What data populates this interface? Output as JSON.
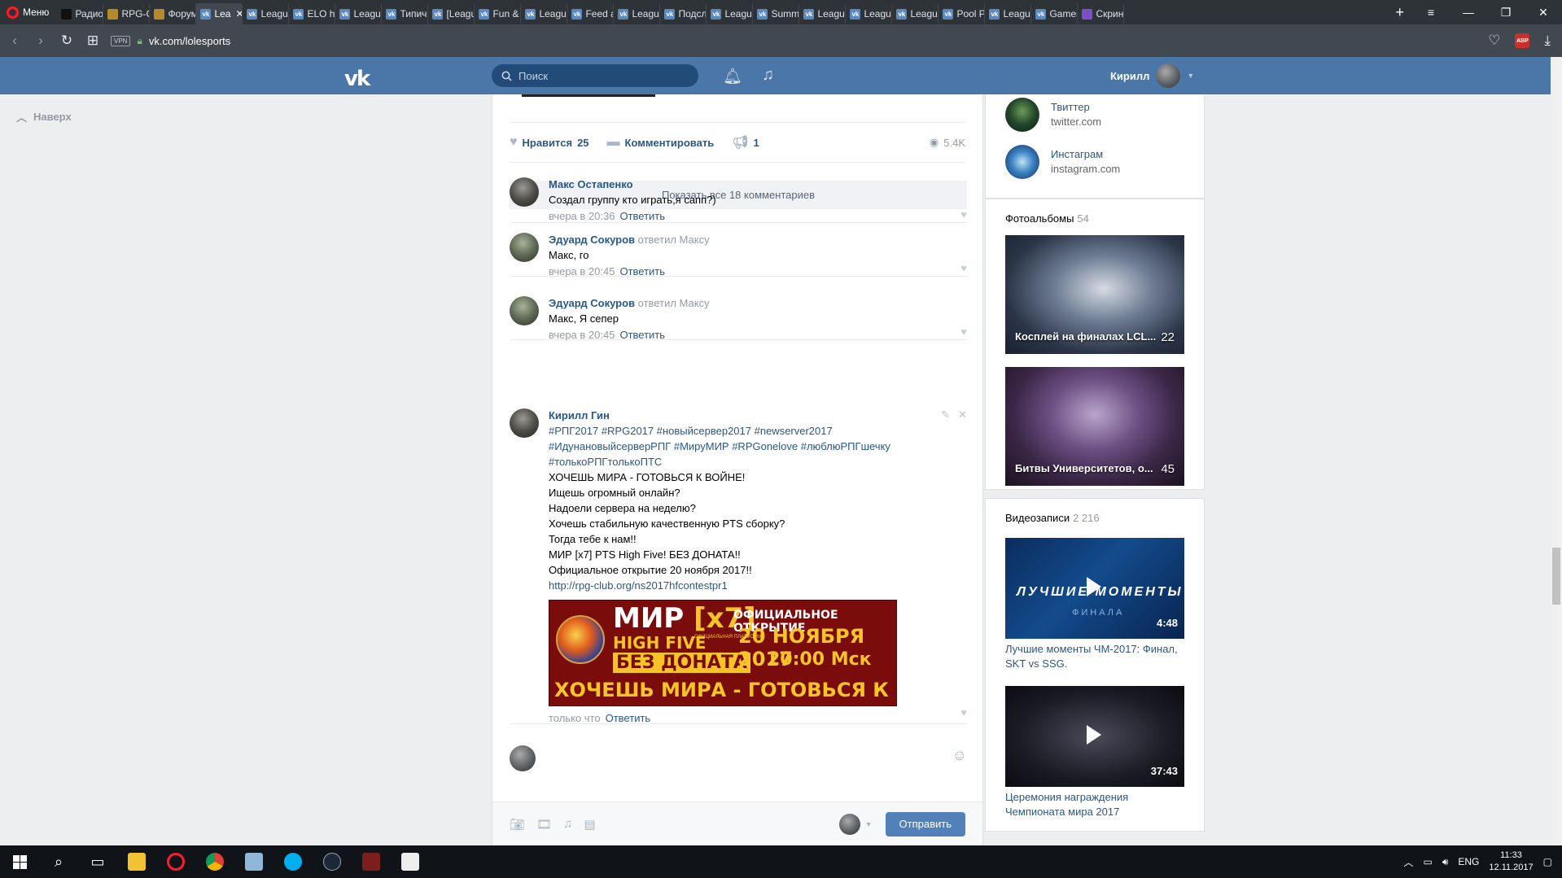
{
  "browser": {
    "menu_label": "Меню",
    "tabs": [
      {
        "label": "Радио",
        "icon": "dark"
      },
      {
        "label": "RPG-C",
        "icon": "gold"
      },
      {
        "label": "Форум",
        "icon": "gold"
      },
      {
        "label": "Lea",
        "icon": "vk",
        "active": true
      },
      {
        "label": "League",
        "icon": "vk"
      },
      {
        "label": "ELO he",
        "icon": "vk"
      },
      {
        "label": "League",
        "icon": "vk"
      },
      {
        "label": "Типич",
        "icon": "vk"
      },
      {
        "label": "[Leagu",
        "icon": "vk"
      },
      {
        "label": "Fun &",
        "icon": "vk"
      },
      {
        "label": "League",
        "icon": "vk"
      },
      {
        "label": "Feed a",
        "icon": "vk"
      },
      {
        "label": "League",
        "icon": "vk"
      },
      {
        "label": "Подсл",
        "icon": "vk"
      },
      {
        "label": "League",
        "icon": "vk"
      },
      {
        "label": "Summ",
        "icon": "vk"
      },
      {
        "label": "League",
        "icon": "vk"
      },
      {
        "label": "League",
        "icon": "vk"
      },
      {
        "label": "League",
        "icon": "vk"
      },
      {
        "label": "Pool P",
        "icon": "vk"
      },
      {
        "label": "League",
        "icon": "vk"
      },
      {
        "label": "Games",
        "icon": "vk"
      },
      {
        "label": "Скрин",
        "icon": "purple"
      }
    ],
    "url": "vk.com/lolesports",
    "vpn_label": "VPN",
    "abp_label": "ABP"
  },
  "vk": {
    "search_placeholder": "Поиск",
    "user_name": "Кирилл",
    "back_to_top": "Наверх"
  },
  "post": {
    "like_label": "Нравится",
    "like_count": "25",
    "comment_label": "Комментировать",
    "share_count": "1",
    "views": "5.4K",
    "show_all": "Показать все 18 комментариев",
    "reply_label": "Ответить",
    "send_label": "Отправить",
    "comments": [
      {
        "author": "Макс Остапенко",
        "replied": "",
        "text": "Создал группу кто играть,я сапп?)",
        "time": "вчера в 20:36"
      },
      {
        "author": "Эдуард Сокуров",
        "replied": "ответил Максу",
        "text": "Макс, го",
        "time": "вчера в 20:45"
      },
      {
        "author": "Эдуард Сокуров",
        "replied": "ответил Максу",
        "text": "Макс, Я сепер",
        "time": "вчера в 20:45"
      }
    ],
    "own_comment": {
      "author": "Кирилл Гин",
      "hashtags_1": "#РПГ2017 #RPG2017 #новыйсервер2017 #newserver2017",
      "hashtags_2": "#ИдунановыйсерверРПГ #МируМИР #RPGonelove #люблюРПГшечку",
      "hashtags_3": "#толькоРПГтолькоПТС",
      "lines": [
        "ХОЧЕШЬ МИРА - ГОТОВЬСЯ К ВОЙНЕ!",
        "Ищешь огромный онлайн?",
        "Надоели сервера на неделю?",
        "Хочешь стабильную качественную PTS сборку?",
        "Тогда тебе к нам!!",
        "МИР [x7] PTS High Five! БЕЗ ДОНАТА!!",
        "Официальное открытие 20 ноября 2017!!"
      ],
      "link": "http://rpg-club.org/ns2017hfcontestpr1",
      "time": "только что",
      "banner": {
        "title": "МИР",
        "title_rate": "[x7]",
        "subtitle": "HIGH FIVE",
        "subtitle_small": "ОФИЦИАЛЬНАЯ ПЛАТФОРМА",
        "nodonate": "БЕЗ ДОНАТА",
        "opening": "ОФИЦИАЛЬНОЕ ОТКРЫТИЕ",
        "date": "20 НОЯБРЯ 2017",
        "time": "20:00 Мск",
        "slogan": "ХОЧЕШЬ МИРА - ГОТОВЬСЯ К ВОЙНЕ"
      }
    }
  },
  "sidebar": {
    "links": [
      {
        "name": "Твиттер",
        "sub": "twitter.com"
      },
      {
        "name": "Инстаграм",
        "sub": "instagram.com"
      }
    ],
    "albums_title": "Фотоальбомы",
    "albums_count": "54",
    "albums": [
      {
        "title": "Косплей на финалах LCL...",
        "count": "22"
      },
      {
        "title": "Битвы Университетов, о...",
        "count": "45"
      }
    ],
    "videos_title": "Видеозаписи",
    "videos_count": "2 216",
    "videos": [
      {
        "overlay": "ЛУЧШИЕ МОМЕНТЫ",
        "overlay_sub": "ФИНАЛА",
        "duration": "4:48",
        "title": "Лучшие моменты ЧМ-2017: Финал, SKT vs SSG."
      },
      {
        "duration": "37:43",
        "title": "Церемония награждения Чемпионата мира 2017"
      }
    ]
  },
  "taskbar": {
    "lang": "ENG",
    "time": "11:33",
    "date": "12.11.2017"
  }
}
